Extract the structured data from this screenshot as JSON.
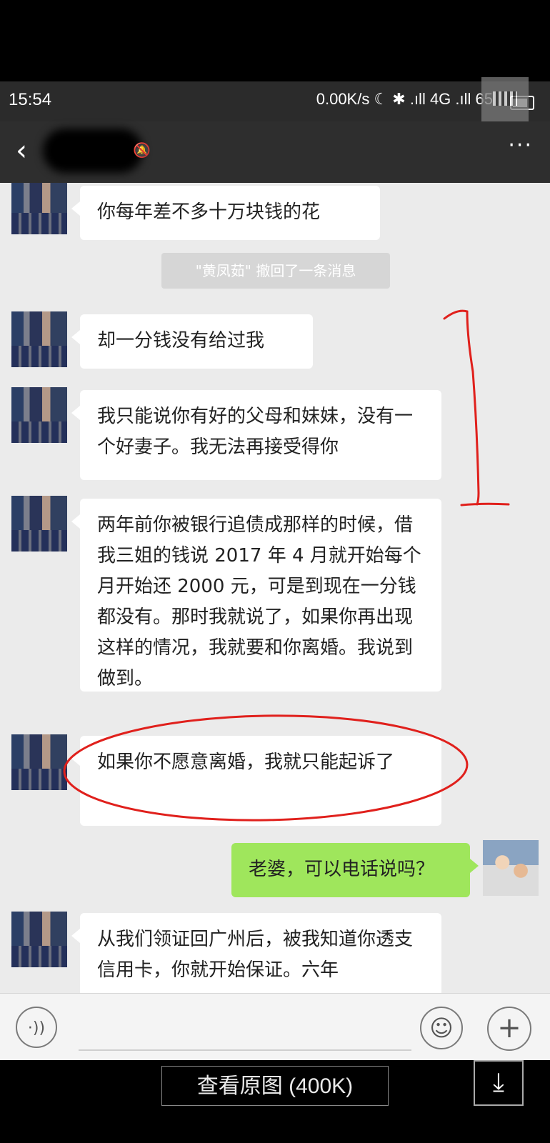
{
  "status": {
    "time": "15:54",
    "indicators": "0.00K/s ☾ ✱ .ıll 4G .ıll 65"
  },
  "header": {
    "contact_name": "",
    "back_icon": "‹",
    "more_icon": "···"
  },
  "messages": [
    {
      "side": "left",
      "text": "你每年差不多十万块钱的花"
    },
    {
      "side": "system",
      "text": "\"黄凤茹\" 撤回了一条消息"
    },
    {
      "side": "left",
      "text": "却一分钱没有给过我"
    },
    {
      "side": "left",
      "text": "我只能说你有好的父母和妹妹，没有一个好妻子。我无法再接受得你"
    },
    {
      "side": "left",
      "text": "两年前你被银行追债成那样的时候，借我三姐的钱说 2017 年 4 月就开始每个月开始还 2000 元，可是到现在一分钱都没有。那时我就说了，如果你再出现这样的情况，我就要和你离婚。我说到做到。"
    },
    {
      "side": "left",
      "text": "如果你不愿意离婚，我就只能起诉了"
    },
    {
      "side": "right",
      "text": "老婆，可以电话说吗？"
    },
    {
      "side": "left",
      "text": "从我们领证回广州后，被我知道你透支信用卡，你就开始保证。六年"
    }
  ],
  "input_bar": {
    "voice_icon": "·))",
    "emoji_icon": "☺",
    "plus_icon": "+"
  },
  "viewer": {
    "view_original_label": "查看原图 (400K)",
    "download_icon": "⤓"
  },
  "annotation_colors": {
    "pen": "#e0201c"
  }
}
